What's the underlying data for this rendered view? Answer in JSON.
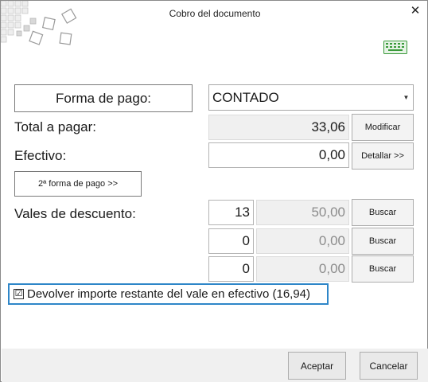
{
  "window": {
    "title": "Cobro del documento"
  },
  "payment": {
    "method_button": "Forma de pago:",
    "method_value": "CONTADO",
    "total_label": "Total a pagar:",
    "total_value": "33,06",
    "modify_button": "Modificar",
    "cash_label": "Efectivo:",
    "cash_value": "0,00",
    "detail_button": "Detallar >>",
    "second_method_button": "2ª forma de pago >>"
  },
  "vouchers": {
    "label": "Vales de descuento:",
    "rows": [
      {
        "number": "13",
        "amount": "50,00",
        "search": "Buscar"
      },
      {
        "number": "0",
        "amount": "0,00",
        "search": "Buscar"
      },
      {
        "number": "0",
        "amount": "0,00",
        "search": "Buscar"
      }
    ]
  },
  "refund_checkbox": {
    "checked": true,
    "mark": "☑",
    "label": "Devolver importe restante del vale en efectivo (16,94)"
  },
  "footer": {
    "accept": "Aceptar",
    "cancel": "Cancelar"
  },
  "icons": {
    "logo": "squares-logo-icon",
    "keyboard": "keyboard-icon",
    "close": "close-icon"
  },
  "colors": {
    "accent": "#2e86c8",
    "keyboard": "#3a9a3a"
  }
}
